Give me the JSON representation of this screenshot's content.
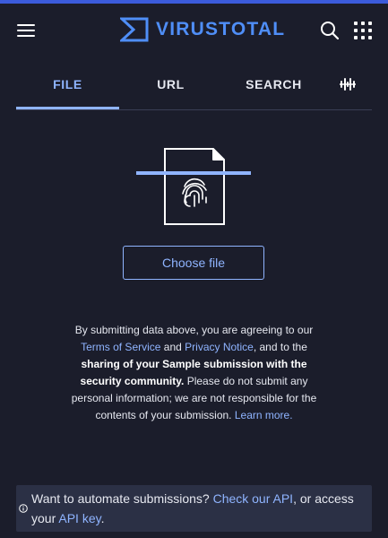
{
  "header": {
    "brand": "VIRUSTOTAL",
    "brand_color": "#4f8ef7",
    "accent_color": "#3b5bdb",
    "icons": {
      "menu": "hamburger-menu-icon",
      "logo": "virustotal-sigma-logo",
      "search": "search-icon",
      "apps": "apps-grid-icon"
    }
  },
  "tabs": [
    {
      "label": "FILE",
      "active": true
    },
    {
      "label": "URL",
      "active": false
    },
    {
      "label": "SEARCH",
      "active": false
    },
    {
      "label": "",
      "icon": "voice-waveform-icon",
      "active": false
    }
  ],
  "upload": {
    "illustration": "fingerprint-document-icon",
    "button_label": "Choose file"
  },
  "disclaimer": {
    "t1": "By submitting data above, you are agreeing to our ",
    "terms_link": "Terms of Service",
    "t2": " and ",
    "privacy_link": "Privacy Notice",
    "t3": ", and to the ",
    "bold": "sharing of your Sample submission with the security community.",
    "t4": " Please do not submit any personal information; we are not responsible for the contents of your submission. ",
    "learn_link": "Learn more."
  },
  "api_banner": {
    "icon": "info-icon",
    "t1": "Want to automate submissions? ",
    "api_link": "Check our API",
    "t2": ", or access your ",
    "key_link": "API key",
    "t3": "."
  },
  "colors": {
    "background": "#1b1d2b",
    "link": "#8fb4ff",
    "banner": "#2b3045"
  }
}
